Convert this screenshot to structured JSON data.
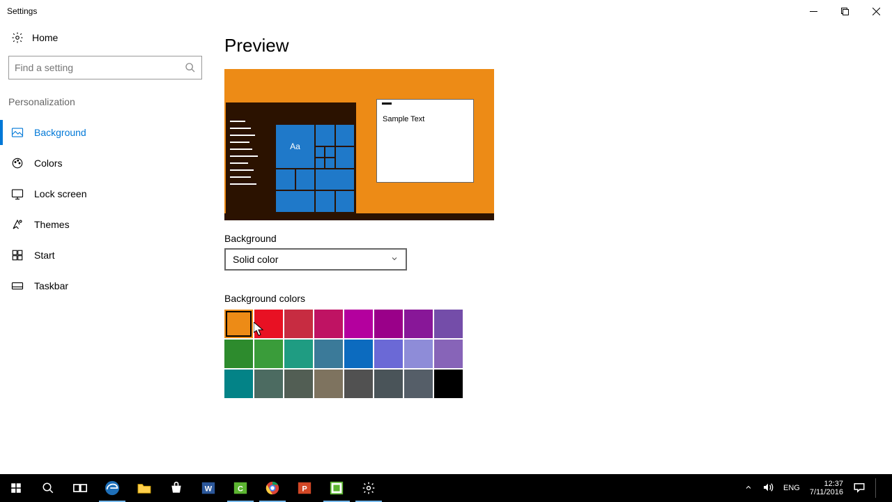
{
  "window": {
    "title": "Settings"
  },
  "sidebar": {
    "home": "Home",
    "search_placeholder": "Find a setting",
    "category": "Personalization",
    "items": [
      {
        "label": "Background",
        "active": true
      },
      {
        "label": "Colors"
      },
      {
        "label": "Lock screen"
      },
      {
        "label": "Themes"
      },
      {
        "label": "Start"
      },
      {
        "label": "Taskbar"
      }
    ]
  },
  "main": {
    "heading": "Preview",
    "sample_text": "Sample Text",
    "tile_text": "Aa",
    "background_label": "Background",
    "background_value": "Solid color",
    "colors_label": "Background colors",
    "selected_color_index": 0,
    "colors": [
      "#ed8b16",
      "#e81123",
      "#c72c41",
      "#bf1363",
      "#b4009e",
      "#9a0089",
      "#881798",
      "#744da9",
      "#2d8b2d",
      "#3a9c3a",
      "#1f9c82",
      "#3b7a99",
      "#0c6bbf",
      "#6b69d6",
      "#8e8cd8",
      "#8764b8",
      "#038387",
      "#4c6b61",
      "#525e54",
      "#7e735f",
      "#515151",
      "#4a5459",
      "#555e68",
      "#000000"
    ]
  },
  "taskbar": {
    "lang": "ENG",
    "time": "12:37",
    "date": "7/11/2016"
  }
}
